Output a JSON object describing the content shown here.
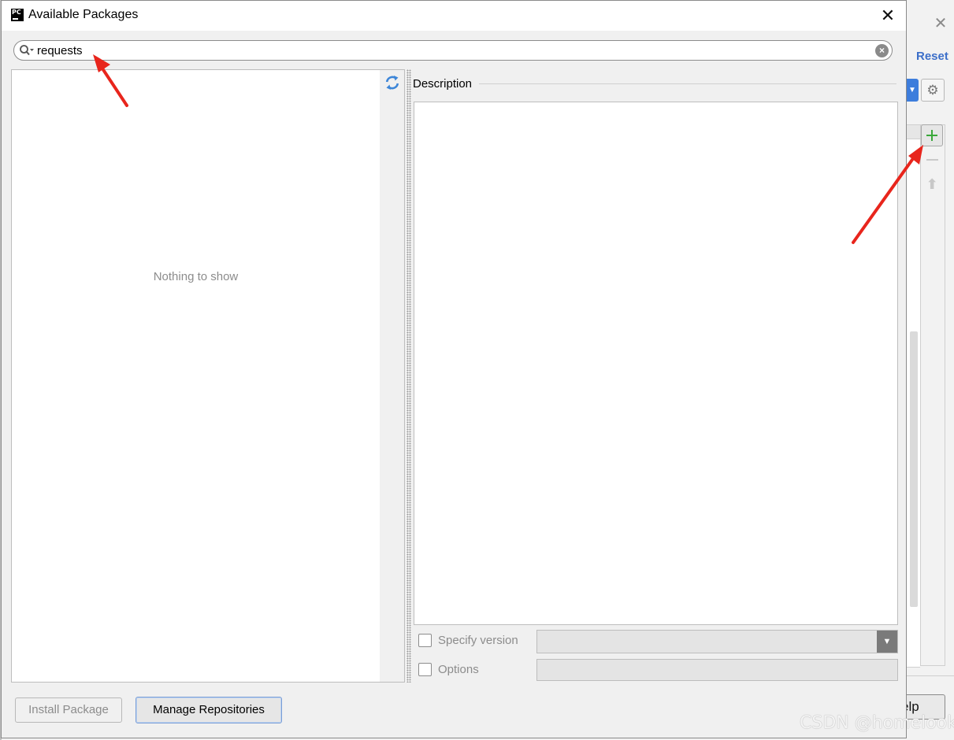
{
  "dialog": {
    "app_icon_text": "PC",
    "title": "Available Packages",
    "close_glyph": "✕"
  },
  "search": {
    "value": "requests",
    "clear_glyph": "×"
  },
  "package_list": {
    "empty_text": "Nothing to show",
    "reload_icon": "reload-icon"
  },
  "description": {
    "label": "Description",
    "content": ""
  },
  "options": {
    "specify_version_label": "Specify version",
    "specify_version_checked": false,
    "version_value": "",
    "options_label": "Options",
    "options_checked": false,
    "options_value": ""
  },
  "buttons": {
    "install": "Install Package",
    "install_enabled": false,
    "manage_repositories": "Manage Repositories"
  },
  "background_window": {
    "close_glyph": "✕",
    "reset_link": "Reset",
    "help_button": "elp"
  },
  "watermark": "CSDN @homelook",
  "colors": {
    "annotation_arrow": "#e8251c",
    "reset_link": "#3c6fc9",
    "add_icon": "#3aa83a",
    "reload_icon": "#3d86d8"
  }
}
